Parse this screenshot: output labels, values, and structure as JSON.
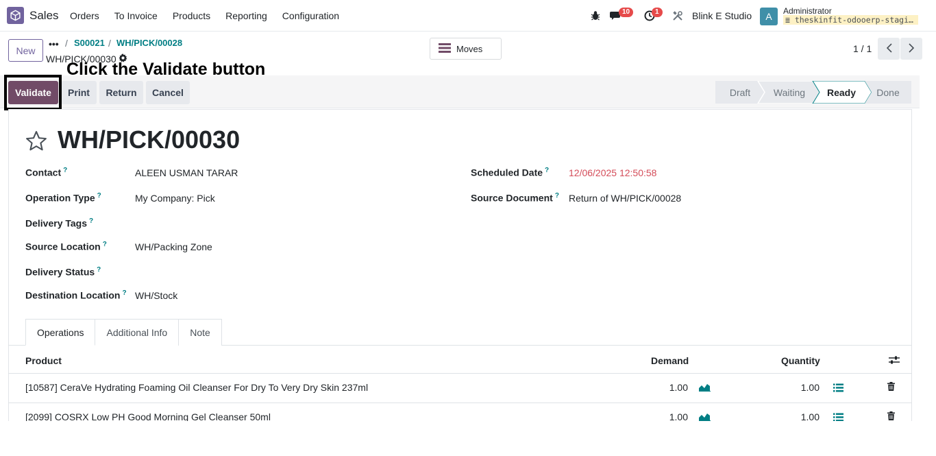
{
  "navbar": {
    "app_name": "Sales",
    "menu": [
      "Orders",
      "To Invoice",
      "Products",
      "Reporting",
      "Configuration"
    ],
    "messages_badge": "10",
    "activities_badge": "1",
    "company": "Blink E Studio",
    "avatar_letter": "A",
    "user_name": "Administrator",
    "database": "theskinfit-odooerp-staging…"
  },
  "control_panel": {
    "new_label": "New",
    "breadcrumb_dots": "•••",
    "breadcrumbs": [
      "S00021",
      "WH/PICK/00028"
    ],
    "current": "WH/PICK/00030",
    "moves_label": "Moves",
    "pager": "1 / 1"
  },
  "annotation": "Click the Validate button",
  "status_bar": {
    "buttons": [
      "Validate",
      "Print",
      "Return",
      "Cancel"
    ],
    "stages": [
      "Draft",
      "Waiting",
      "Ready",
      "Done"
    ],
    "active_stage": "Ready"
  },
  "form": {
    "title": "WH/PICK/00030",
    "fields_left": [
      {
        "label": "Contact",
        "value": "ALEEN USMAN TARAR"
      },
      {
        "label": "Operation Type",
        "value": "My Company: Pick"
      },
      {
        "label": "Delivery Tags",
        "value": ""
      },
      {
        "label": "Source Location",
        "value": "WH/Packing Zone"
      },
      {
        "label": "Delivery Status",
        "value": ""
      },
      {
        "label": "Destination Location",
        "value": "WH/Stock"
      }
    ],
    "fields_right": [
      {
        "label": "Scheduled Date",
        "value": "12/06/2025 12:50:58"
      },
      {
        "label": "Source Document",
        "value": "Return of WH/PICK/00028"
      }
    ],
    "help_mark": "?"
  },
  "tabs": [
    "Operations",
    "Additional Info",
    "Note"
  ],
  "table": {
    "headers": {
      "product": "Product",
      "demand": "Demand",
      "quantity": "Quantity"
    },
    "rows": [
      {
        "product": "[10587] CeraVe Hydrating Foaming Oil Cleanser For Dry To Very Dry Skin 237ml",
        "demand": "1.00",
        "quantity": "1.00"
      },
      {
        "product": "[2099] COSRX Low PH Good Morning Gel Cleanser 50ml",
        "demand": "1.00",
        "quantity": "1.00"
      }
    ]
  },
  "colors": {
    "primary": "#714b67",
    "link": "#017e84",
    "danger_date": "#d44c59",
    "badge": "#e64a4a"
  }
}
